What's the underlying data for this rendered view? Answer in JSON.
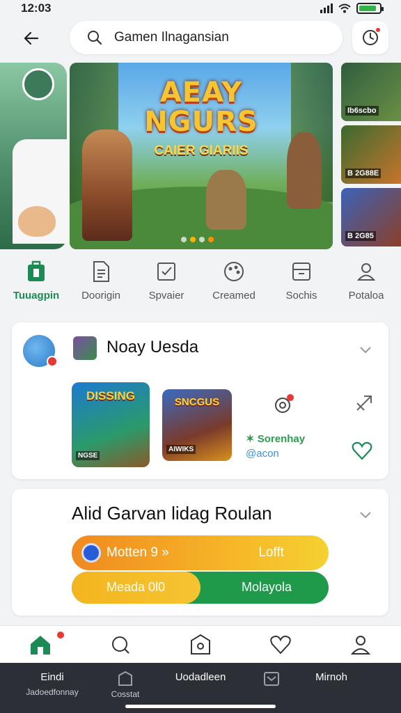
{
  "status": {
    "time": "12:03"
  },
  "search": {
    "value": "Gamen Ilnagansian"
  },
  "banner": {
    "title_line1": "AEAY",
    "title_line2": "NGURS",
    "subtitle": "CAIER GIARIIS"
  },
  "side_thumbs": [
    {
      "label": "Ib6scbo",
      "color": "#2f5e3e"
    },
    {
      "label": "B 2G88E",
      "color": "#3a6a2f"
    },
    {
      "label": "B 2G85",
      "color": "#3b63b7"
    }
  ],
  "categories": [
    {
      "label": "Tuuagpin",
      "icon": "store-icon",
      "active": true
    },
    {
      "label": "Doorigin",
      "icon": "document-icon",
      "active": false
    },
    {
      "label": "Spvaier",
      "icon": "checkbox-icon",
      "active": false
    },
    {
      "label": "Creamed",
      "icon": "palette-icon",
      "active": false
    },
    {
      "label": "Sochis",
      "icon": "archive-icon",
      "active": false
    },
    {
      "label": "Potaloa",
      "icon": "user-icon",
      "active": false
    }
  ],
  "card1": {
    "title": "Noay Uesda",
    "tile1": {
      "title": "DISSING",
      "badge": "NGSE"
    },
    "tile2": {
      "title": "SNCGUS",
      "badge": "AIWIKS"
    },
    "meta_line1": "✶ Sorenhay",
    "meta_line2": "@acon"
  },
  "card2": {
    "title": "Alid Garvan lidag Roulan",
    "bar1_left": "Motten 9 »",
    "bar1_right": "Lofft",
    "bar2_left": "Meada 0l0",
    "bar2_right": "Molayola",
    "bar2_progress": 0.5
  },
  "bottom_nav": [
    {
      "icon": "home-icon",
      "active": true
    },
    {
      "icon": "search-icon",
      "active": false
    },
    {
      "icon": "shield-icon",
      "active": false
    },
    {
      "icon": "heart-icon",
      "active": false
    },
    {
      "icon": "profile-icon",
      "active": false
    }
  ],
  "system_bar": {
    "item1": "Eindi",
    "item1_sub": "Jadoedfonnay",
    "item2_sub": "Cosstat",
    "item3": "Uodadleen",
    "item5": "Mirnoh"
  },
  "colors": {
    "accent": "#1b8a55",
    "badge": "#e53935",
    "bar_orange": "#f08a1f",
    "bar_green": "#1f9a4b"
  }
}
